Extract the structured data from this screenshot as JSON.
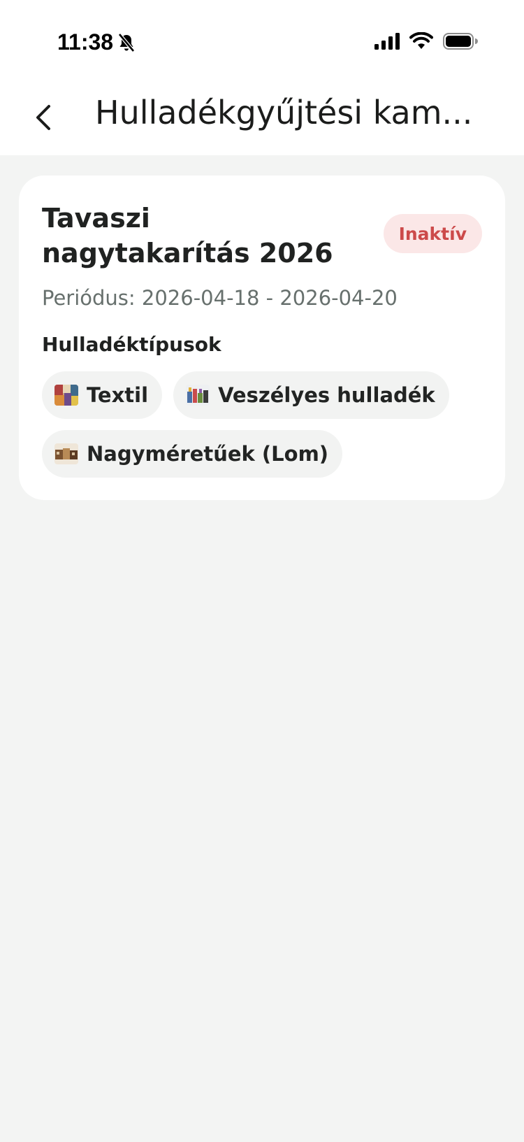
{
  "status_bar": {
    "time": "11:38"
  },
  "header": {
    "title": "Hulladékgyűjtési kam..."
  },
  "card": {
    "title": "Tavaszi nagytakarítás 2026",
    "status_badge": "Inaktív",
    "period": "Periódus: 2026-04-18 - 2026-04-20",
    "section_label": "Hulladéktípusok",
    "waste_types": [
      {
        "label": "Textil"
      },
      {
        "label": "Veszélyes hulladék"
      },
      {
        "label": "Nagyméretűek (Lom)"
      }
    ]
  },
  "colors": {
    "background": "#f3f4f3",
    "card": "#ffffff",
    "badge_bg": "#fbe7e7",
    "badge_text": "#cc4a4a",
    "chip_bg": "#f2f3f2"
  }
}
